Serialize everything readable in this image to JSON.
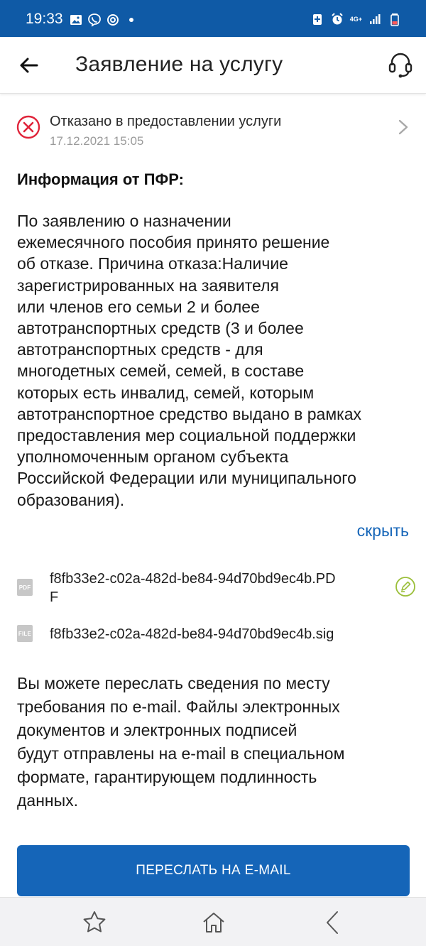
{
  "status_bar": {
    "time": "19:33",
    "network": "4G+",
    "icons": [
      "gallery-icon",
      "viber-icon",
      "sync-icon",
      "dot-icon",
      "battery-saver-icon",
      "alarm-icon",
      "signal-icon",
      "battery-icon"
    ]
  },
  "app_bar": {
    "title": "Заявление на услугу",
    "back_icon": "arrow-left-icon",
    "support_icon": "headset-icon"
  },
  "status": {
    "icon": "rejected-icon",
    "text": "Отказано в предоставлении услуги",
    "date": "17.12.2021 15:05",
    "color": "#e0243a"
  },
  "info": {
    "heading": "Информация от ПФР:",
    "lines": [
      "По заявлению о назначении",
      "ежемесячного пособия принято решение",
      "об отказе. Причина отказа:Наличие",
      "зарегистрированных на заявителя",
      "или членов его семьи 2 и более",
      "автотранспортных средств (3 и более",
      "автотранспортных средств - для",
      "многодетных семей, семей, в составе",
      "которых есть инвалид, семей, которым",
      "автотранспортное средство выдано в рамках",
      "предоставления мер социальной поддержки",
      "уполномоченным органом субъекта",
      "Российской Федерации или муниципального",
      "образования)."
    ],
    "hide_label": "скрыть"
  },
  "files": [
    {
      "badge": "PDF",
      "name_line1": "f8fb33e2-c02a-482d-be84-94d70bd9ec4b.PD",
      "name_line2": "F",
      "has_signature": true
    },
    {
      "badge": "FILE",
      "name_line1": "f8fb33e2-c02a-482d-be84-94d70bd9ec4b.sig",
      "name_line2": "",
      "has_signature": false
    }
  ],
  "forward": {
    "lines": [
      "Вы можете переслать сведения по месту",
      "требования по e-mail. Файлы электронных",
      "документов и электронных подписей",
      "будут отправлены на e-mail в специальном",
      "формате, гарантирующем подлинность",
      "данных."
    ],
    "button_label": "ПЕРЕСЛАТЬ НА E-MAIL"
  },
  "bottom_nav": {
    "items": [
      "star-icon",
      "home-icon",
      "back-chevron-icon"
    ]
  },
  "colors": {
    "primary": "#1565b8",
    "status_bar": "#0f5aa6",
    "signature_icon": "#9bbf3a"
  }
}
